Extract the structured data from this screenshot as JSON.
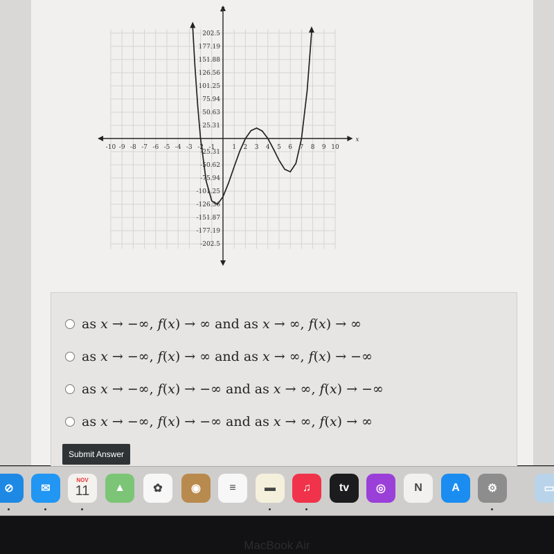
{
  "chart_data": {
    "type": "line",
    "xlabel": "x",
    "ylabel": "y",
    "xlim": [
      -10,
      10
    ],
    "ylim": [
      -202.5,
      202.5
    ],
    "grid": true,
    "x_ticks": [
      "-10",
      "-9",
      "-8",
      "-7",
      "-6",
      "-5",
      "-4",
      "-3",
      "-2",
      "-1",
      "1",
      "2",
      "3",
      "4",
      "5",
      "6",
      "7",
      "8",
      "9",
      "10"
    ],
    "y_ticks": [
      "202.5",
      "177.19",
      "151.88",
      "126.56",
      "101.25",
      "75.94",
      "50.63",
      "25.31",
      "-25.31",
      "-50.62",
      "-75.94",
      "-101.25",
      "-126.56",
      "-151.87",
      "-177.19",
      "-202.5"
    ],
    "series": [
      {
        "x": [
          -2.7,
          -2.5,
          -2.25,
          -2,
          -1.5,
          -1,
          -0.5,
          0,
          0.5,
          1,
          1.5,
          2,
          2.5,
          3,
          3.5,
          4,
          4.5,
          5,
          5.5,
          6,
          6.5,
          7,
          7.5,
          7.9
        ],
        "y": [
          213.8,
          138.9,
          61.4,
          0,
          -81.8,
          -120,
          -126.6,
          -112,
          -85.3,
          -54,
          -24.1,
          0,
          15.2,
          20,
          14.4,
          0,
          -20.3,
          -42,
          -59.1,
          -64,
          -47.8,
          0,
          91.4,
          205
        ]
      }
    ]
  },
  "options": [
    {
      "label": "as 𝑥 → −∞, 𝑓(𝑥) → ∞ and as 𝑥 → ∞, 𝑓(𝑥) → ∞",
      "selected": false
    },
    {
      "label": "as 𝑥 → −∞, 𝑓(𝑥) → ∞ and as 𝑥 → ∞, 𝑓(𝑥) → −∞",
      "selected": false
    },
    {
      "label": "as 𝑥 → −∞, 𝑓(𝑥) → −∞ and as 𝑥 → ∞, 𝑓(𝑥) → −∞",
      "selected": false
    },
    {
      "label": "as 𝑥 → −∞, 𝑓(𝑥) → −∞ and as 𝑥 → ∞, 𝑓(𝑥) → ∞",
      "selected": false
    }
  ],
  "submit_label": "Submit Answer",
  "dock": {
    "apps": [
      {
        "name": "safari",
        "color": "#1e88e5",
        "glyph": "⊘"
      },
      {
        "name": "mail",
        "color": "#2196f3",
        "glyph": "✉"
      },
      {
        "name": "calendar",
        "color": "#f4f2ee",
        "glyph": "11",
        "month": "NOV"
      },
      {
        "name": "maps",
        "color": "#7cc576",
        "glyph": "▲"
      },
      {
        "name": "photos",
        "color": "#f7f7f7",
        "glyph": "✿"
      },
      {
        "name": "contacts",
        "color": "#b98a4e",
        "glyph": "◉"
      },
      {
        "name": "reminders",
        "color": "#f7f7f7",
        "glyph": "≡"
      },
      {
        "name": "notes",
        "color": "#f5f0dc",
        "glyph": "▬"
      },
      {
        "name": "music",
        "color": "#f0334a",
        "glyph": "♫"
      },
      {
        "name": "tv",
        "color": "#1c1c1e",
        "glyph": "tv"
      },
      {
        "name": "podcasts",
        "color": "#9b3fd9",
        "glyph": "◎"
      },
      {
        "name": "news",
        "color": "#f3f1ef",
        "glyph": "N"
      },
      {
        "name": "app-store",
        "color": "#1b8cf0",
        "glyph": "A"
      },
      {
        "name": "system-settings",
        "color": "#8d8d8d",
        "glyph": "⚙"
      },
      {
        "name": "preview",
        "color": "#b9d4ea",
        "glyph": "▭"
      }
    ]
  },
  "device_label": "MacBook Air"
}
